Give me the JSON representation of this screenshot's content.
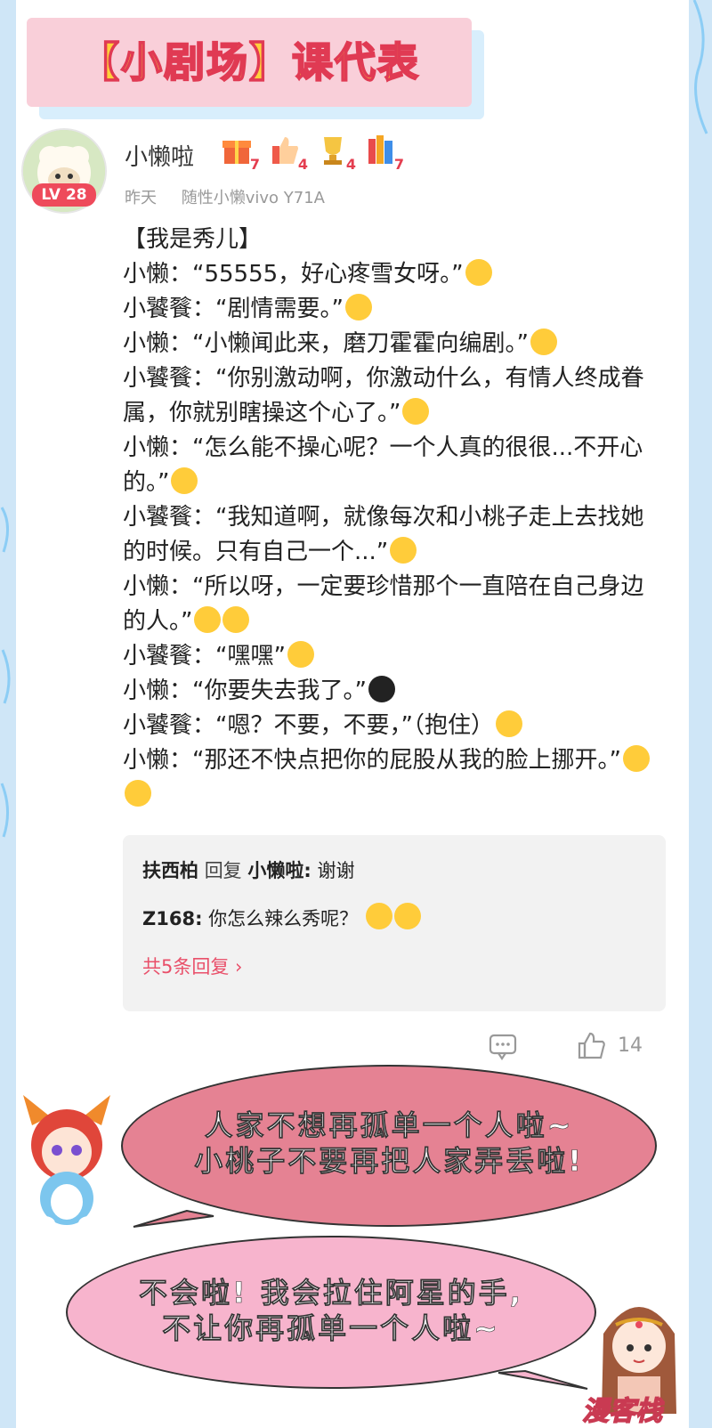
{
  "title": "【小剧场】课代表",
  "post": {
    "author": "小懒啦",
    "level": "LV 28",
    "medals": [
      {
        "icon": "gift-medal-icon",
        "count": "7"
      },
      {
        "icon": "thumbs-up-medal-icon",
        "count": "4"
      },
      {
        "icon": "trophy-medal-icon",
        "count": "4"
      },
      {
        "icon": "books-medal-icon",
        "count": "7"
      }
    ],
    "time": "昨天",
    "device": "随性小懒vivo Y71A",
    "lines": [
      "【我是秀儿】",
      "小懒：“55555，好心疼雪女呀。”",
      "小饕餮：“剧情需要。”",
      "小懒：“小懒闻此来，磨刀霍霍向编剧。”",
      "小饕餮：“你别激动啊，你激动什么，有情人终成眷属，你就别瞎操这个心了。”",
      "小懒：“怎么能不操心呢？一个人真的很很...不开心的。”",
      "小饕餮：“我知道啊，就像每次和小桃子走上去找她的时候。只有自己一个...”",
      "小懒：“所以呀，一定要珍惜那个一直陪在自己身边的人。”",
      "小饕餮：“嘿嘿”",
      "小懒：“你要失去我了。”",
      "小饕餮：“嗯？不要，不要，”（抱住）",
      "小懒：“那还不快点把你的屁股从我的脸上挪开。”"
    ]
  },
  "replies": {
    "r1_user": "扶西柏",
    "r1_mid": "回复",
    "r1_target": "小懒啦:",
    "r1_text": "谢谢",
    "r2_user": "Z168:",
    "r2_text": "你怎么辣么秀呢？",
    "more": "共5条回复 ›"
  },
  "actions": {
    "like_count": "14"
  },
  "bubbles": {
    "b1_line1": "人家不想再孤单一个人啦~",
    "b1_line2": "小桃子不要再把人家弄丢啦!",
    "b2_line1": "不会啦! 我会拉住阿星的手,",
    "b2_line2": "不让你再孤单一个人啦~"
  },
  "watermark": "漫客栈",
  "colors": {
    "accent": "#e9506a",
    "bubble1": "#e58293",
    "bubble2": "#f7b4cd",
    "background": "#cfe6f7"
  }
}
